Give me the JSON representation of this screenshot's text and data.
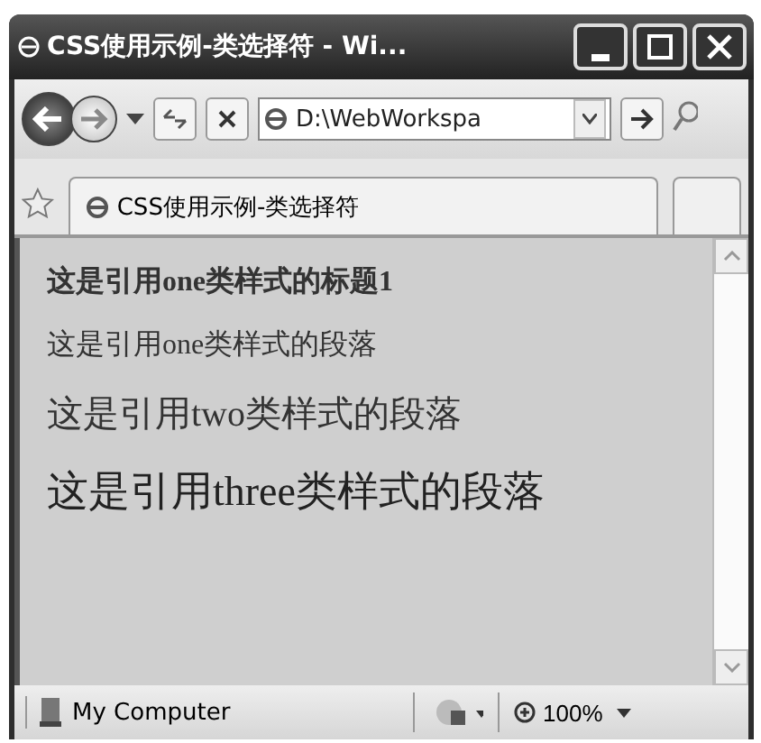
{
  "window": {
    "title": "CSS使用示例-类选择符 - Wi..."
  },
  "address_bar": {
    "value": "D:\\WebWorkspa"
  },
  "tabs": [
    {
      "label": "CSS使用示例-类选择符",
      "selected": true
    }
  ],
  "content": [
    {
      "kind": "heading",
      "text": "这是引用one类样式的标题1"
    },
    {
      "kind": "small",
      "text": "这是引用one类样式的段落"
    },
    {
      "kind": "medium",
      "text": "这是引用two类样式的段落"
    },
    {
      "kind": "large",
      "text": "这是引用three类样式的段落"
    }
  ],
  "status_bar": {
    "zone": "My Computer",
    "zoom": "100%"
  }
}
